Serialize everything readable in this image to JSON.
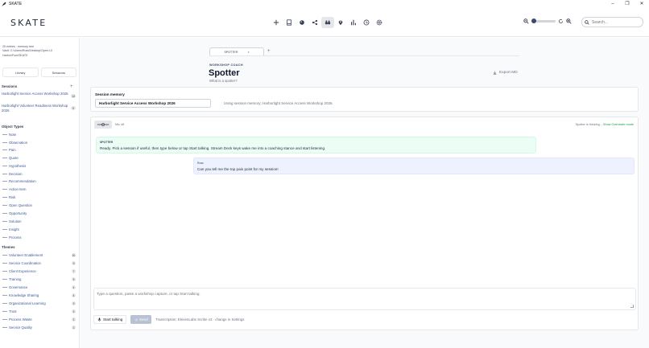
{
  "window": {
    "title": "SKATE",
    "icon": "feather-icon"
  },
  "header": {
    "logo": "SKATE",
    "toolbar_icons": [
      "plus-icon",
      "book-icon",
      "palette-icon",
      "share-icon",
      "binoculars-icon",
      "pin-icon",
      "chart-icon",
      "clock-icon",
      "gear-icon"
    ],
    "active_tool": "binoculars-icon",
    "zoom": {
      "level": 0
    },
    "search": {
      "placeholder": "Search..."
    }
  },
  "sidebar": {
    "vault_lines": [
      "25 entries · memory tree",
      "Vault: C:\\Users\\Ross\\Desktop\\Open-UI",
      "Harbor\\Fsm\\SKATE"
    ],
    "tabs": [
      "Library",
      "Sessions"
    ],
    "sessions_heading": "Sessions",
    "sessions": [
      {
        "label": "Harborlight Service Access Workshop 2026",
        "count": "13"
      },
      {
        "label": "Harborlight Volunteer Readiness Workshop 2026",
        "count": "0"
      }
    ],
    "object_types_heading": "Object Types",
    "object_types": [
      "Note",
      "Observation",
      "Pain",
      "Quote",
      "Hypothesis",
      "Decision",
      "Recommendation",
      "Action Item",
      "Risk",
      "Open Question",
      "Opportunity",
      "Solution",
      "Insight",
      "Process"
    ],
    "themes_heading": "Themes",
    "themes": [
      {
        "label": "Volunteer Enablement",
        "count": "10"
      },
      {
        "label": "Service Coordination",
        "count": "9"
      },
      {
        "label": "Client Experience",
        "count": "7"
      },
      {
        "label": "Training",
        "count": "5"
      },
      {
        "label": "Governance",
        "count": "4"
      },
      {
        "label": "Knowledge Sharing",
        "count": "4"
      },
      {
        "label": "Organizational Learning",
        "count": "3"
      },
      {
        "label": "Trust",
        "count": "3"
      },
      {
        "label": "Process Waste",
        "count": "2"
      },
      {
        "label": "Service Quality",
        "count": "2"
      }
    ]
  },
  "main": {
    "tab": {
      "label": "SPOTTER",
      "new_tab": "+"
    },
    "eyebrow": "WORKSHOP COACH",
    "title": "Spotter",
    "subtitle": "What is a spotter?",
    "export_label": "Export MD",
    "memory": {
      "label": "Session memory",
      "selected": "Harborlight Service Access Workshop 2026",
      "note": "Using session memory: Harborlight Service Access Workshop 2026."
    },
    "chat": {
      "mic_label": "Mic off",
      "status": "Spotter is thinking...",
      "status_link": "Show Overdrafe mode",
      "messages": [
        {
          "role": "SPOTTER",
          "text": "Ready. Pick a session if useful, then type below or tap Start talking. Stream Deck keys wake me into a coaching stance and start listening."
        },
        {
          "role": "Ross",
          "text": "Can you tell me the top pain point for my session!"
        }
      ]
    },
    "composer": {
      "placeholder": "Type a question, paste a workshop capture, or tap Start talking.",
      "start_label": "Start talking",
      "send_label": "Send",
      "transcription": "Transcription: ElevenLabs Scribe v2 · change in Settings"
    }
  }
}
